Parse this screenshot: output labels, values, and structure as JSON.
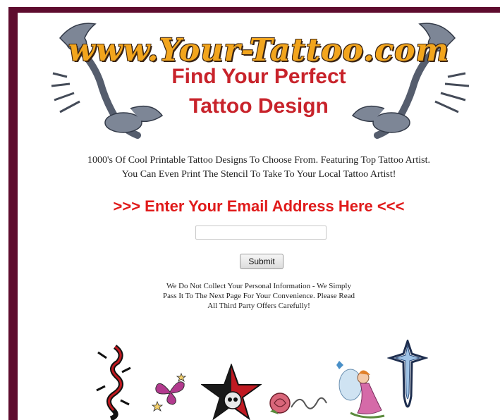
{
  "header": {
    "logo": "www.Your-Tattoo.com",
    "headline_line1": "Find Your Perfect",
    "headline_line2": "Tattoo Design"
  },
  "tagline": {
    "line1": "1000's Of Cool Printable Tattoo Designs To Choose From. Featuring Top Tattoo Artist.",
    "line2": "You Can Even Print The Stencil To Take To Your Local Tattoo Artist!"
  },
  "cta": ">>> Enter Your Email Address Here <<<",
  "form": {
    "email_value": "",
    "submit_label": "Submit"
  },
  "notice": {
    "line1": "We Do Not Collect Your Personal Information - We Simply",
    "line2": "Pass It To The Next Page For Your Convenience.  Please Read",
    "line3": "All Third Party Offers Carefully!"
  },
  "gallery": {
    "items": [
      "dragon-tattoo",
      "butterfly-stars-tattoo",
      "skull-star-tattoo",
      "rose-script-tattoo",
      "fairy-tattoo",
      "tribal-cross-tattoo"
    ]
  },
  "colors": {
    "frame": "#5e0c2e",
    "headline": "#c8232b",
    "cta": "#e01b1b",
    "logo": "#f2a51d"
  }
}
